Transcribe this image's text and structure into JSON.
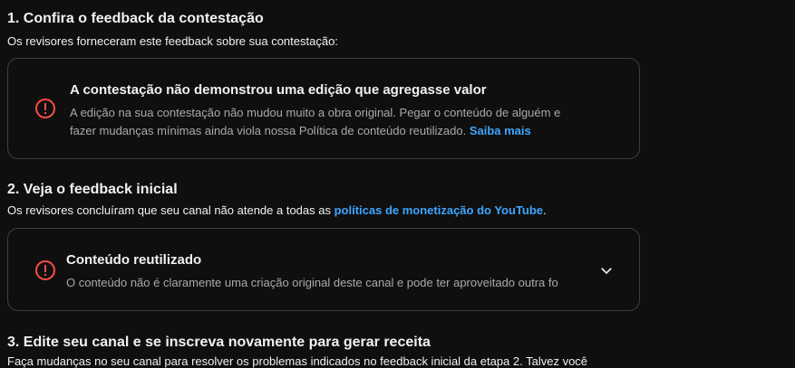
{
  "step1": {
    "title": "1. Confira o feedback da contestação",
    "subtitle": "Os revisores forneceram este feedback sobre sua contestação:",
    "card": {
      "icon": "alert-circle-icon",
      "title": "A contestação não demonstrou uma edição que agregasse valor",
      "body_line1": "A edição na sua contestação não mudou muito a obra original. Pegar o conteúdo de alguém e",
      "body_line2": "fazer mudanças mínimas ainda viola nossa Política de conteúdo reutilizado. ",
      "link": "Saiba mais"
    }
  },
  "step2": {
    "title": "2. Veja o feedback inicial",
    "subtitle_prefix": "Os revisores concluíram que seu canal não atende a todas as ",
    "subtitle_link": "políticas de monetização do YouTube",
    "subtitle_suffix": ".",
    "card": {
      "icon": "alert-circle-icon",
      "title": "Conteúdo reutilizado",
      "body": "O conteúdo não é claramente uma criação original deste canal e pode ter aproveitado outra fo",
      "expand_icon": "chevron-down-icon"
    }
  },
  "step3": {
    "title": "3. Edite seu canal e se inscreva novamente para gerar receita",
    "subtitle": "Faça mudanças no seu canal para resolver os problemas indicados no feedback inicial da etapa 2. Talvez você"
  },
  "colors": {
    "background": "#0f0f0f",
    "text": "#f1f1f1",
    "muted": "#aaaaaa",
    "link": "#3ea6ff",
    "alert": "#ff4e45",
    "border": "#3f3f3f"
  }
}
